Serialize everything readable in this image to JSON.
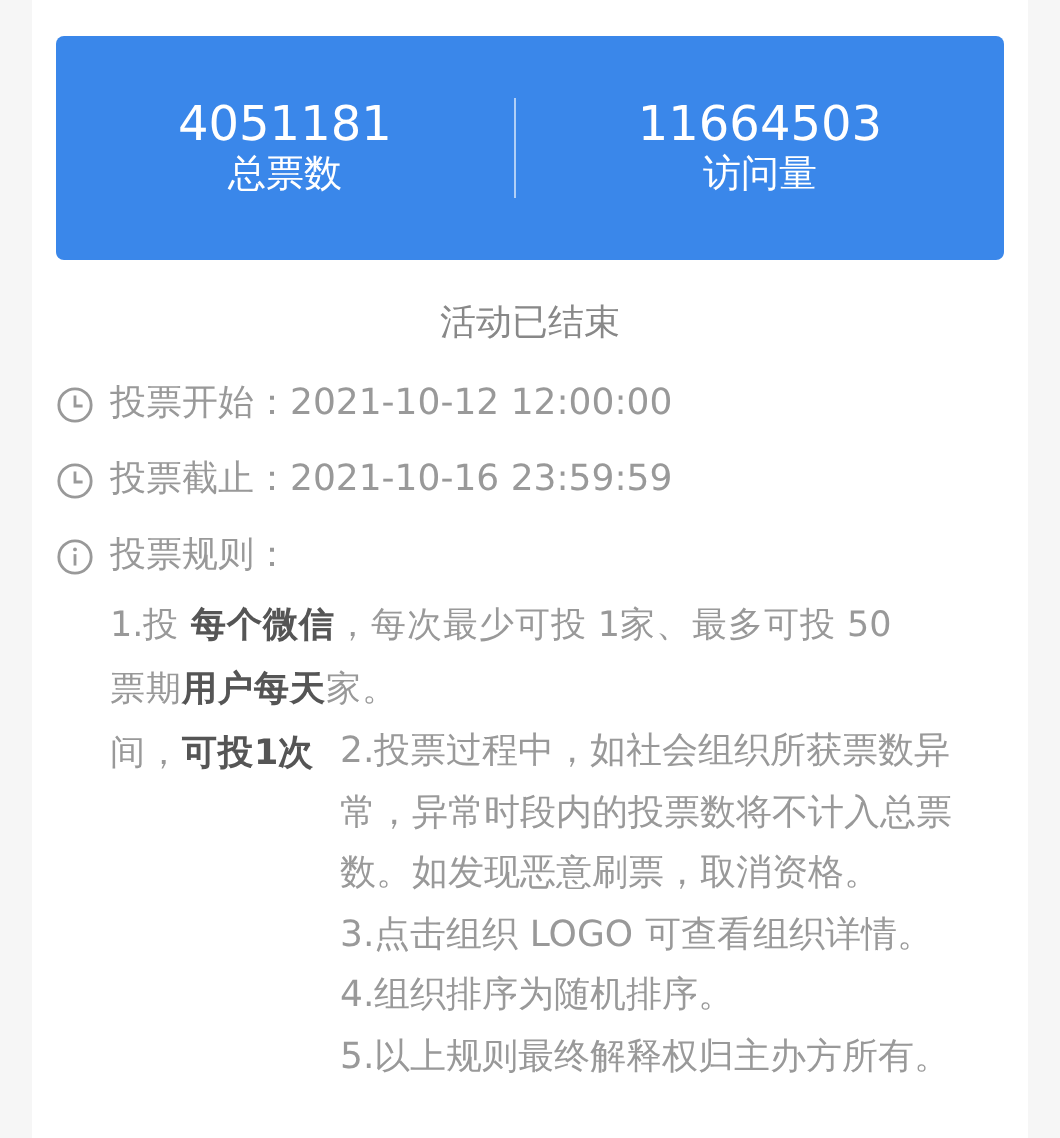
{
  "stats": [
    {
      "value": "4051181",
      "label": "总票数"
    },
    {
      "value": "11664503",
      "label": "访问量"
    }
  ],
  "status": "活动已结束",
  "schedule": [
    {
      "label": "投票开始：",
      "value": "2021-10-12 12:00:00"
    },
    {
      "label": "投票截止：",
      "value": "2021-10-16 23:59:59"
    }
  ],
  "rules": {
    "title": "投票规则：",
    "fragments": [
      "1.投 **每个微信**，每次最少可投 1家、最多可投 50",
      "票期**用户每天**家。",
      "间，**可投1次**"
    ],
    "items": [
      "2.投票过程中，如社会组织所获票数异常，异常时段内的投票数将不计入总票数。如发现恶意刷票，取消资格。",
      "3.点击组织 LOGO 可查看组织详情。",
      "4.组织排序为随机排序。",
      "5.以上规则最终解释权归主办方所有。"
    ]
  }
}
